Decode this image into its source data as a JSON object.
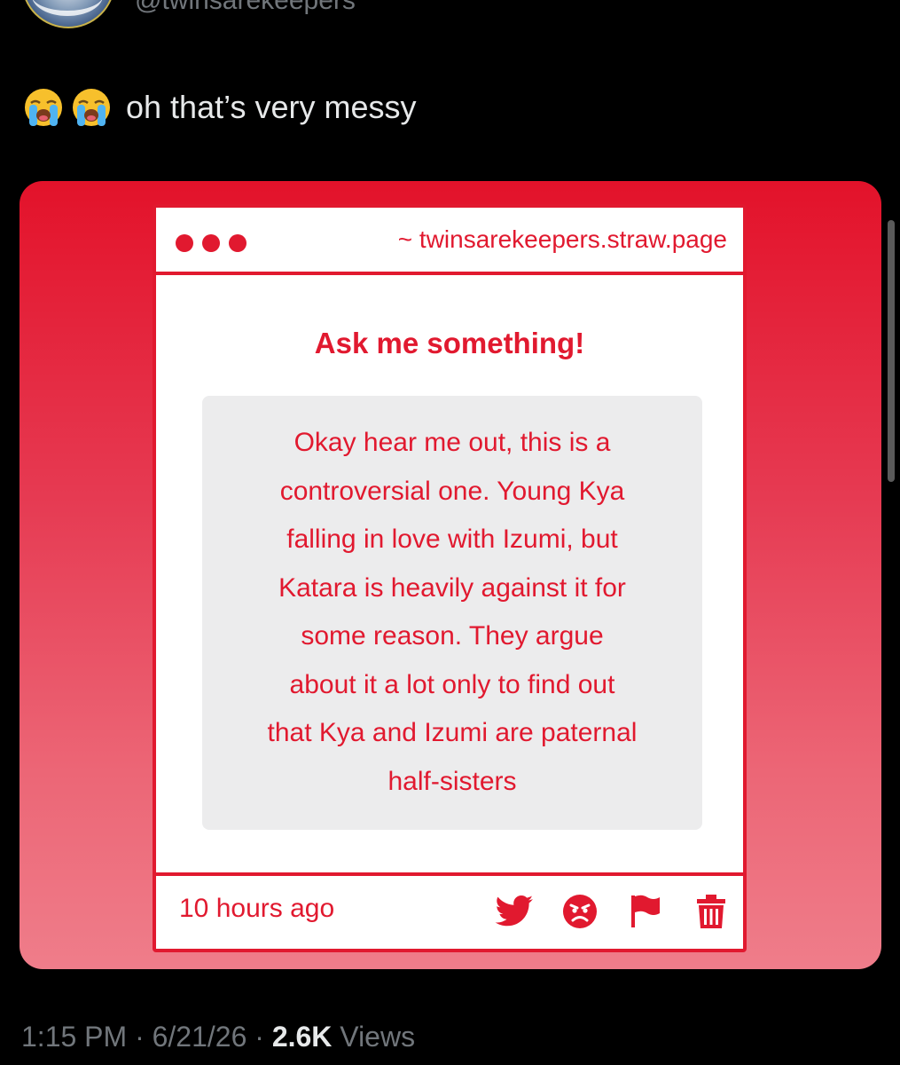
{
  "author": {
    "handle": "@twinsarekeepers"
  },
  "tweet": {
    "text": "oh that’s very messy",
    "emojis": [
      "loudly-crying-face",
      "loudly-crying-face"
    ]
  },
  "card": {
    "url": "~ twinsarekeepers.straw.page",
    "title": "Ask me something!",
    "question_lines": [
      "Okay hear me out, this is a",
      "controversial one. Young Kya",
      "falling in love with Izumi, but",
      "Katara is heavily against it for",
      "some reason. They argue",
      "about it a lot only to find out",
      "that Kya and Izumi are paternal",
      "half-sisters"
    ],
    "time_ago": "10 hours ago",
    "actions": [
      "twitter-icon",
      "angry-face-icon",
      "flag-icon",
      "trash-icon"
    ],
    "accent_color": "#e1192f"
  },
  "meta": {
    "time": "1:15 PM",
    "separator": "·",
    "date": "6/21/26",
    "views_count": "2.6K",
    "views_label": "Views"
  }
}
